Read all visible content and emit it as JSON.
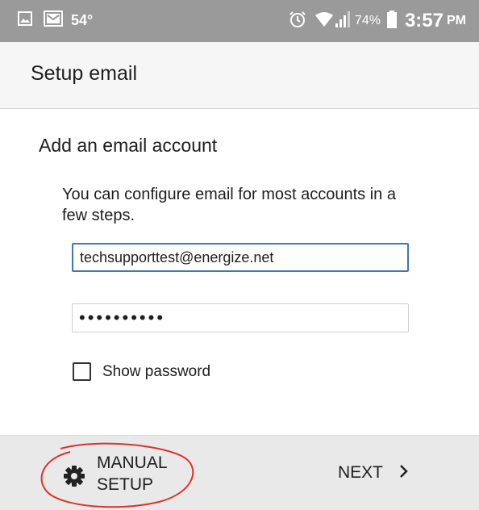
{
  "status_bar": {
    "temperature": "54°",
    "battery_percent": "74%",
    "time": "3:57",
    "ampm": "PM",
    "icons": [
      "image-icon",
      "mail-icon",
      "alarm-icon",
      "wifi-icon",
      "signal-icon",
      "battery-icon"
    ]
  },
  "app_bar": {
    "title": "Setup email"
  },
  "section": {
    "title": "Add an email account",
    "description": "You can configure email for most accounts in a few steps."
  },
  "email_field": {
    "value": "techsupporttest@energize.net"
  },
  "password_field": {
    "value": "••••••••••"
  },
  "show_password": {
    "label": "Show password",
    "checked": false
  },
  "bottom_bar": {
    "manual_setup_label": "MANUAL\nSETUP",
    "next_label": "NEXT",
    "icons": [
      "gear-icon",
      "chevron-right-icon"
    ]
  },
  "colors": {
    "status_bar_bg": "#9a9a9a",
    "app_bar_bg": "#f6f6f6",
    "bottom_bar_bg": "#e9e9e9",
    "email_focus_border": "#3d78b8",
    "annotation_circle": "#e0322a"
  }
}
